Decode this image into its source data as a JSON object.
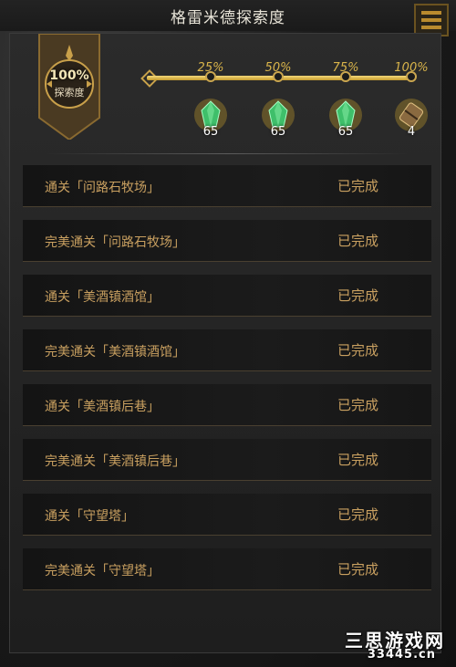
{
  "header": {
    "title": "格雷米德探索度"
  },
  "exploration": {
    "percent": "100%",
    "label": "探索度",
    "progress": 1.0
  },
  "milestones": [
    {
      "percent": "25%",
      "reward_icon": "green-crystal-icon",
      "count": "65"
    },
    {
      "percent": "50%",
      "reward_icon": "green-crystal-icon",
      "count": "65"
    },
    {
      "percent": "75%",
      "reward_icon": "green-crystal-icon",
      "count": "65"
    },
    {
      "percent": "100%",
      "reward_icon": "scroll-icon",
      "count": "4"
    }
  ],
  "tasks": [
    {
      "name": "通关「问路石牧场」",
      "status": "已完成"
    },
    {
      "name": "完美通关「问路石牧场」",
      "status": "已完成"
    },
    {
      "name": "通关「美酒镇酒馆」",
      "status": "已完成"
    },
    {
      "name": "完美通关「美酒镇酒馆」",
      "status": "已完成"
    },
    {
      "name": "通关「美酒镇后巷」",
      "status": "已完成"
    },
    {
      "name": "完美通关「美酒镇后巷」",
      "status": "已完成"
    },
    {
      "name": "通关「守望塔」",
      "status": "已完成"
    },
    {
      "name": "完美通关「守望塔」",
      "status": "已完成"
    }
  ],
  "watermark": {
    "text": "三思游戏网",
    "sub": "33445.cn"
  },
  "colors": {
    "gold": "#c9a060",
    "accent": "#d9b44a",
    "crystal": "#3fbf6a"
  }
}
